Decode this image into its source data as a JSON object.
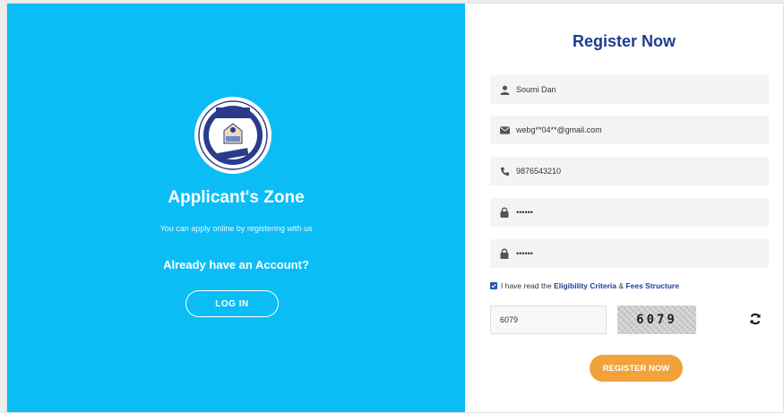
{
  "left_panel": {
    "title": "Applicant's Zone",
    "subtitle": "You can apply online by registering with us",
    "already": "Already have an Account?",
    "login_label": "LOG IN",
    "logo_icon": "university-seal-icon"
  },
  "form": {
    "title": "Register Now",
    "name_value": "Soumi Dan",
    "email_value": "webg**04**@gmail.com",
    "phone_value": "9876543210",
    "password_value": "••••••",
    "confirm_value": "••••••",
    "agree_text_pre": "I have read the",
    "agree_link1": "Eligibility Criteria",
    "agree_amp": "&",
    "agree_link2": "Fees Structure",
    "captcha_value": "6079",
    "captcha_code": "6079",
    "register_label": "REGISTER NOW"
  },
  "colors": {
    "left_bg": "#0bbdf5",
    "title_blue": "#1d3b8f",
    "button_orange": "#f1a23b"
  }
}
